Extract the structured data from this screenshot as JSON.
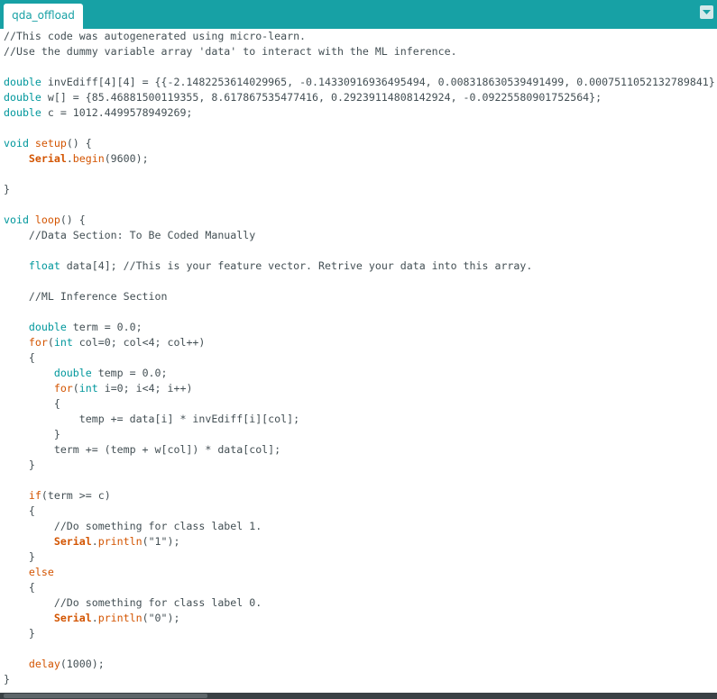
{
  "tabs": [
    {
      "label": "qda_offload"
    }
  ],
  "tab_menu_icon": "chevron-down-icon",
  "colors": {
    "tabbar": "#17a1a5",
    "keyword": "#00979c",
    "function": "#d35400",
    "text": "#434f54"
  },
  "editor": {
    "lines": [
      [
        {
          "t": "//This code was autogenerated using micro-learn.",
          "c": "comment"
        }
      ],
      [
        {
          "t": "//Use the dummy variable array 'data' to interact with the ML inference.",
          "c": "comment"
        }
      ],
      [],
      [
        {
          "t": "double",
          "c": "keyword"
        },
        {
          "t": " invEdiff[4][4] = {{-2.1482253614029965, -0.14330916936495494, 0.008318630539491499, 0.0007511052132789841}"
        }
      ],
      [
        {
          "t": "double",
          "c": "keyword"
        },
        {
          "t": " w[] = {85.46881500119355, 8.617867535477416, 0.29239114808142924, -0.09225580901752564};"
        }
      ],
      [
        {
          "t": "double",
          "c": "keyword"
        },
        {
          "t": " c = 1012.4499578949269;"
        }
      ],
      [],
      [
        {
          "t": "void",
          "c": "keyword"
        },
        {
          "t": " "
        },
        {
          "t": "setup",
          "c": "func"
        },
        {
          "t": "() {"
        }
      ],
      [
        {
          "t": "    "
        },
        {
          "t": "Serial",
          "c": "class"
        },
        {
          "t": "."
        },
        {
          "t": "begin",
          "c": "func"
        },
        {
          "t": "(9600);"
        }
      ],
      [],
      [
        {
          "t": "}"
        }
      ],
      [],
      [
        {
          "t": "void",
          "c": "keyword"
        },
        {
          "t": " "
        },
        {
          "t": "loop",
          "c": "func"
        },
        {
          "t": "() {"
        }
      ],
      [
        {
          "t": "    "
        },
        {
          "t": "//Data Section: To Be Coded Manually",
          "c": "comment"
        }
      ],
      [],
      [
        {
          "t": "    "
        },
        {
          "t": "float",
          "c": "keyword"
        },
        {
          "t": " data[4]; "
        },
        {
          "t": "//This is your feature vector. Retrive your data into this array.",
          "c": "comment"
        }
      ],
      [],
      [
        {
          "t": "    "
        },
        {
          "t": "//ML Inference Section",
          "c": "comment"
        }
      ],
      [],
      [
        {
          "t": "    "
        },
        {
          "t": "double",
          "c": "keyword"
        },
        {
          "t": " term = 0.0;"
        }
      ],
      [
        {
          "t": "    "
        },
        {
          "t": "for",
          "c": "func"
        },
        {
          "t": "("
        },
        {
          "t": "int",
          "c": "keyword"
        },
        {
          "t": " col=0; col<4; col++)"
        }
      ],
      [
        {
          "t": "    {"
        }
      ],
      [
        {
          "t": "        "
        },
        {
          "t": "double",
          "c": "keyword"
        },
        {
          "t": " temp = 0.0;"
        }
      ],
      [
        {
          "t": "        "
        },
        {
          "t": "for",
          "c": "func"
        },
        {
          "t": "("
        },
        {
          "t": "int",
          "c": "keyword"
        },
        {
          "t": " i=0; i<4; i++)"
        }
      ],
      [
        {
          "t": "        {"
        }
      ],
      [
        {
          "t": "            temp += data[i] * invEdiff[i][col];"
        }
      ],
      [
        {
          "t": "        }"
        }
      ],
      [
        {
          "t": "        term += (temp + w[col]) * data[col];"
        }
      ],
      [
        {
          "t": "    }"
        }
      ],
      [],
      [
        {
          "t": "    "
        },
        {
          "t": "if",
          "c": "func"
        },
        {
          "t": "(term >= c)"
        }
      ],
      [
        {
          "t": "    {"
        }
      ],
      [
        {
          "t": "        "
        },
        {
          "t": "//Do something for class label 1.",
          "c": "comment"
        }
      ],
      [
        {
          "t": "        "
        },
        {
          "t": "Serial",
          "c": "class"
        },
        {
          "t": "."
        },
        {
          "t": "println",
          "c": "func"
        },
        {
          "t": "(\"1\");"
        }
      ],
      [
        {
          "t": "    }"
        }
      ],
      [
        {
          "t": "    "
        },
        {
          "t": "else",
          "c": "func"
        }
      ],
      [
        {
          "t": "    {"
        }
      ],
      [
        {
          "t": "        "
        },
        {
          "t": "//Do something for class label 0.",
          "c": "comment"
        }
      ],
      [
        {
          "t": "        "
        },
        {
          "t": "Serial",
          "c": "class"
        },
        {
          "t": "."
        },
        {
          "t": "println",
          "c": "func"
        },
        {
          "t": "(\"0\");"
        }
      ],
      [
        {
          "t": "    }"
        }
      ],
      [],
      [
        {
          "t": "    "
        },
        {
          "t": "delay",
          "c": "func"
        },
        {
          "t": "(1000);"
        }
      ],
      [
        {
          "t": "}"
        }
      ]
    ],
    "caret_line": 25
  }
}
